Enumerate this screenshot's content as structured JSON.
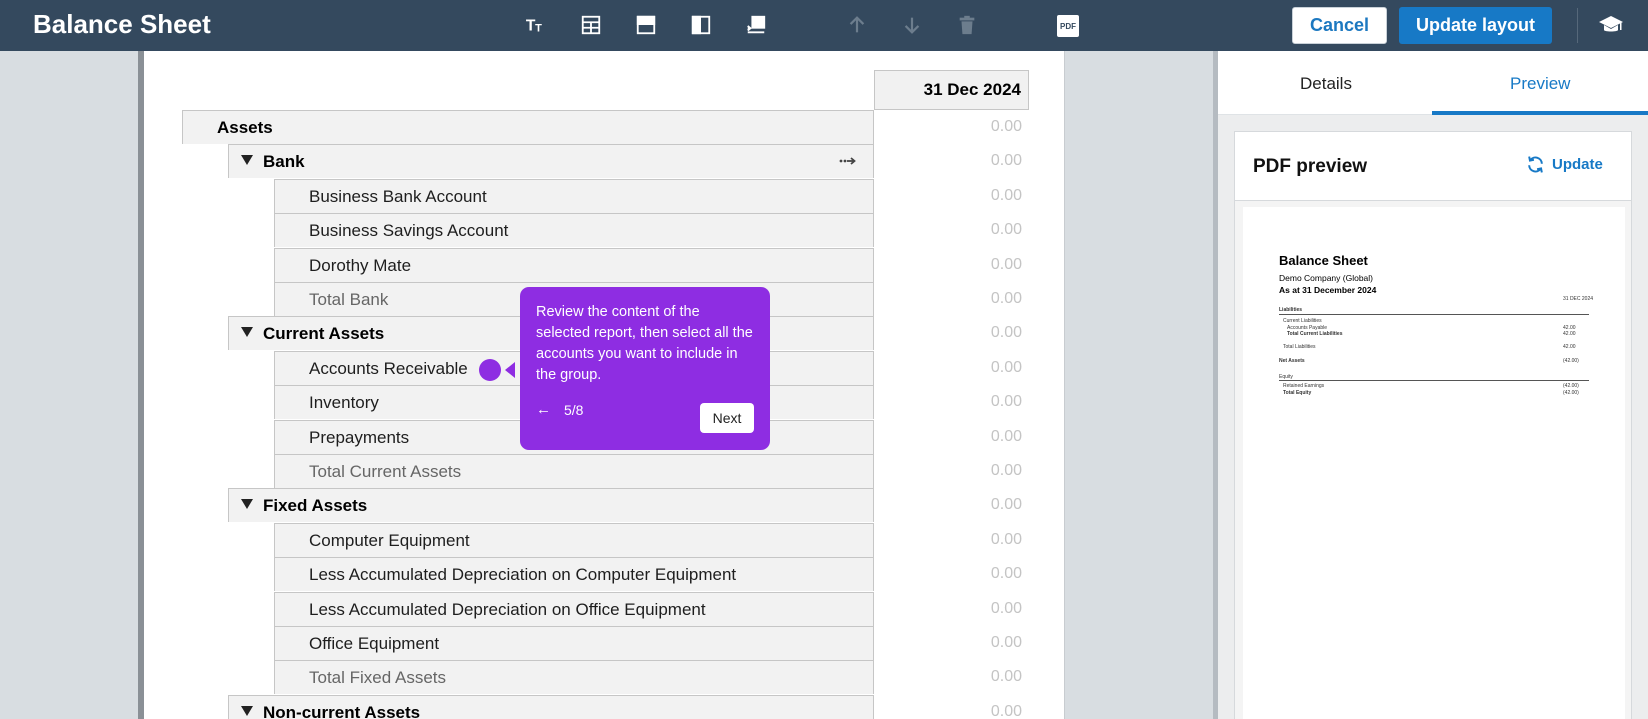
{
  "app": {
    "title": "Balance Sheet"
  },
  "toolbar": {
    "tools": [
      "text-format-icon",
      "table-icon",
      "row-layout-icon",
      "column-layout-icon",
      "insert-icon",
      "arrow-up-icon",
      "arrow-down-icon",
      "trash-icon"
    ],
    "pdf_label": "PDF",
    "cancel_label": "Cancel",
    "update_label": "Update layout"
  },
  "report": {
    "column_header": "31 Dec 2024",
    "rows": [
      {
        "label": "Assets",
        "level": 0,
        "value": "0.00"
      },
      {
        "label": "Bank",
        "level": 1,
        "value": "0.00"
      },
      {
        "label": "Business Bank Account",
        "level": 2,
        "value": "0.00"
      },
      {
        "label": "Business Savings Account",
        "level": 2,
        "value": "0.00"
      },
      {
        "label": "Dorothy Mate",
        "level": 2,
        "value": "0.00"
      },
      {
        "label": "Total Bank",
        "level": 2,
        "value": "0.00"
      },
      {
        "label": "Current Assets",
        "level": 1,
        "value": "0.00"
      },
      {
        "label": "Accounts Receivable",
        "level": 2,
        "value": "0.00"
      },
      {
        "label": "Inventory",
        "level": 2,
        "value": "0.00"
      },
      {
        "label": "Prepayments",
        "level": 2,
        "value": "0.00"
      },
      {
        "label": "Total Current Assets",
        "level": 2,
        "value": "0.00"
      },
      {
        "label": "Fixed Assets",
        "level": 1,
        "value": "0.00"
      },
      {
        "label": "Computer Equipment",
        "level": 2,
        "value": "0.00"
      },
      {
        "label": "Less Accumulated Depreciation on Computer Equipment",
        "level": 2,
        "value": "0.00"
      },
      {
        "label": "Less Accumulated Depreciation on Office Equipment",
        "level": 2,
        "value": "0.00"
      },
      {
        "label": "Office Equipment",
        "level": 2,
        "value": "0.00"
      },
      {
        "label": "Total Fixed Assets",
        "level": 2,
        "value": "0.00"
      },
      {
        "label": "Non-current Assets",
        "level": 1,
        "value": "0.00"
      }
    ]
  },
  "tooltip": {
    "text": "Review the content of the selected report, then select all the accounts you want to include in the group.",
    "back_arrow": "←",
    "step": "5/8",
    "next_label": "Next"
  },
  "panel": {
    "tabs": [
      "Details",
      "Preview"
    ],
    "active_tab": "Preview",
    "preview_title": "PDF preview",
    "refresh_label": "Update",
    "pdf": {
      "title": "Balance Sheet",
      "company": "Demo Company (Global)",
      "as_at": "As at 31 December 2024",
      "date_col": "31 DEC 2024",
      "lines": [
        {
          "label": "Liabilities",
          "value": ""
        },
        {
          "label": "Current Liabilities",
          "value": ""
        },
        {
          "label": "Accounts Payable",
          "value": "42.00"
        },
        {
          "label": "Total Current Liabilities",
          "value": "42.00"
        },
        {
          "label": "Total Liabilities",
          "value": "42.00"
        },
        {
          "label": "Net Assets",
          "value": "(42.00)"
        },
        {
          "label": "Equity",
          "value": ""
        },
        {
          "label": "Retained Earnings",
          "value": "(42.00)"
        },
        {
          "label": "Total Equity",
          "value": "(42.00)"
        }
      ]
    }
  },
  "colors": {
    "topbar": "#34495e",
    "primary": "#1779c6",
    "tooltip": "#8e2de2"
  }
}
